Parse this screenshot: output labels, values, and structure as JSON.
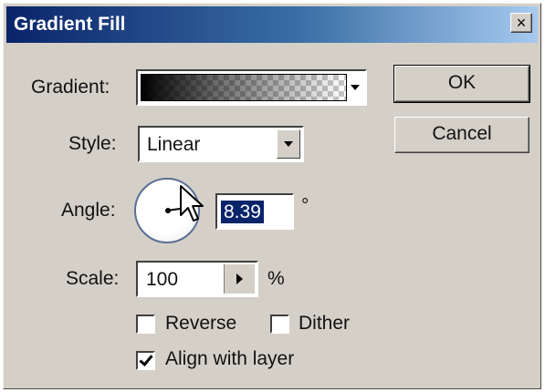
{
  "window": {
    "title": "Gradient Fill",
    "close_label": "×"
  },
  "gradient": {
    "label": "Gradient:"
  },
  "style": {
    "label": "Style:",
    "value": "Linear"
  },
  "angle": {
    "label": "Angle:",
    "value": "8.39",
    "unit": "°"
  },
  "scale": {
    "label": "Scale:",
    "value": "100",
    "unit": "%"
  },
  "options": {
    "reverse": {
      "label": "Reverse",
      "checked": false
    },
    "dither": {
      "label": "Dither",
      "checked": false
    },
    "align": {
      "label": "Align with layer",
      "checked": true
    }
  },
  "buttons": {
    "ok": "OK",
    "cancel": "Cancel"
  },
  "colors": {
    "title_start": "#0a246a",
    "title_end": "#a6caf0",
    "face": "#d4d0c8",
    "selection": "#0a246a"
  },
  "icons": {
    "close": "close-icon",
    "dropdown": "chevron-down-icon",
    "spin": "triangle-right-icon",
    "cursor": "arrow-cursor-icon"
  }
}
